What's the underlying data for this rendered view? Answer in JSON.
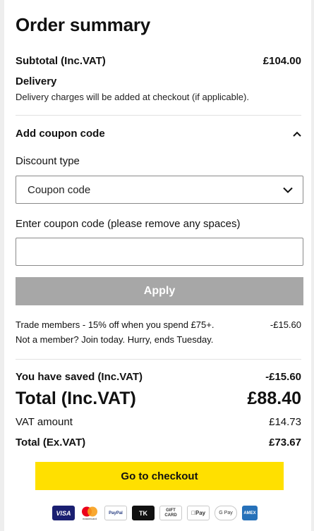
{
  "summary": {
    "title": "Order summary",
    "subtotal_label": "Subtotal (Inc.VAT)",
    "subtotal_value": "£104.00",
    "delivery_label": "Delivery",
    "delivery_note": "Delivery charges will be added at checkout (if applicable)."
  },
  "coupon": {
    "heading": "Add coupon code",
    "discount_type_label": "Discount type",
    "discount_type_value": "Coupon code",
    "code_label": "Enter coupon code (please remove any spaces)",
    "code_value": "",
    "apply_label": "Apply"
  },
  "promo": {
    "line1": "Trade members - 15% off when you spend £75+.",
    "line2": "Not a member? Join today. Hurry, ends Tuesday.",
    "amount": "-£15.60"
  },
  "totals": {
    "saved_label": "You have saved (Inc.VAT)",
    "saved_value": "-£15.60",
    "total_label": "Total (Inc.VAT)",
    "total_value": "£88.40",
    "vat_label": "VAT amount",
    "vat_value": "£14.73",
    "ex_vat_label": "Total (Ex.VAT)",
    "ex_vat_value": "£73.67"
  },
  "checkout": {
    "label": "Go to checkout"
  },
  "payment_methods": {
    "visa": "VISA",
    "mastercard": "mastercard",
    "paypal": "PayPal",
    "tk": "TK",
    "gift": "GIFT CARD",
    "applepay": "Pay",
    "gpay": "G Pay",
    "amex": "AMEX"
  },
  "colors": {
    "checkout_yellow": "#ffe000",
    "apply_disabled": "#a7a7a7",
    "visa_blue": "#1a1f71",
    "amex_blue": "#2671b9"
  }
}
